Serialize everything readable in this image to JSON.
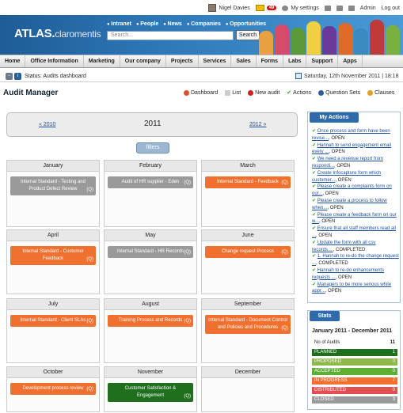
{
  "topbar": {
    "user": "Nigel Davies",
    "badge": "49",
    "settings": "My settings",
    "admin": "Admin",
    "logout": "Log out"
  },
  "banner": {
    "logo_main": "ATLAS.",
    "logo_sub": "claromentis",
    "radios": [
      "Intranet",
      "People",
      "News",
      "Companies",
      "Opportunities"
    ],
    "search_placeholder": "Search...",
    "search_button": "Search"
  },
  "nav": [
    "Home",
    "Office Information",
    "Marketing",
    "Our company",
    "Projects",
    "Services",
    "Sales",
    "Forms",
    "Labs",
    "Support",
    "Apps"
  ],
  "status": {
    "text": "Status: Audits dashboard",
    "date": "Saturday, 12th November 2011 | 18:18"
  },
  "page": {
    "title": "Audit Manager",
    "toolbar": [
      "Dashboard",
      "List",
      "New audit",
      "Actions",
      "Question Sets",
      "Clauses"
    ]
  },
  "year_nav": {
    "prev": "« 2010",
    "year": "2011",
    "next": "2012 »"
  },
  "filters": "filters",
  "months": [
    {
      "name": "January",
      "items": [
        {
          "text": "Internal Standard - Testing and Product Defect Review",
          "tag": "(Q)",
          "color": "gray"
        }
      ]
    },
    {
      "name": "February",
      "items": [
        {
          "text": "Audit of HR supplier - Eden",
          "tag": "(Q)",
          "color": "gray"
        }
      ]
    },
    {
      "name": "March",
      "items": [
        {
          "text": "Internal Standard - Feedback",
          "tag": "(Q)",
          "color": "orange"
        }
      ]
    },
    {
      "name": "April",
      "items": [
        {
          "text": "Internal Standard - Customer Feedback",
          "tag": "(Q)",
          "color": "orange"
        }
      ]
    },
    {
      "name": "May",
      "items": [
        {
          "text": "Internal Standard - HR Records",
          "tag": "(Q)",
          "color": "gray"
        }
      ]
    },
    {
      "name": "June",
      "items": [
        {
          "text": "Change request Process",
          "tag": "(Q)",
          "color": "orange"
        }
      ]
    },
    {
      "name": "July",
      "items": [
        {
          "text": "Internal Standard - Client SLAs",
          "tag": "(Q)",
          "color": "orange"
        }
      ]
    },
    {
      "name": "August",
      "items": [
        {
          "text": "Training Process and Records",
          "tag": "(Q)",
          "color": "orange"
        }
      ]
    },
    {
      "name": "September",
      "items": [
        {
          "text": "Internal Standard - Document Control and Policies and Procedures",
          "tag": "(Q)",
          "color": "orange"
        }
      ]
    },
    {
      "name": "October",
      "items": [
        {
          "text": "Development process review",
          "tag": "(Q)",
          "color": "orange"
        }
      ]
    },
    {
      "name": "November",
      "items": [
        {
          "text": "Customer Satisfaction & Engagement",
          "tag": "(Q)",
          "color": "green"
        }
      ]
    },
    {
      "name": "December",
      "items": []
    }
  ],
  "my_actions": {
    "title": "My Actions",
    "items": [
      {
        "link": "Once process and form have been revise...",
        "status": ", OPEN"
      },
      {
        "link": "Hannah to send engagement email every ...",
        "status": ", OPEN"
      },
      {
        "link": "We need a revenue report from respondi...",
        "status": ", OPEN"
      },
      {
        "link": "Create Infocapture form which customer...",
        "status": ", OPEN"
      },
      {
        "link": "Please create a complaints form on our...",
        "status": ", OPEN"
      },
      {
        "link": "Please create a process to follow when...",
        "status": ", OPEN"
      },
      {
        "link": "Please create a feedback form on our w...",
        "status": ", OPEN"
      },
      {
        "link": "Ensure that all staff members read all ...",
        "status": ", OPEN"
      },
      {
        "link": "Update the form with all csv records....",
        "status": ", COMPLETED"
      },
      {
        "link": "1. Hannah to re-do the change request ...",
        "status": ", COMPLETED"
      },
      {
        "link": "Hannah to re-do enhancements requests ...",
        "status": ", OPEN"
      },
      {
        "link": "Managers to be more serious while appr...",
        "status": ", OPEN"
      }
    ]
  },
  "stats": {
    "title": "Stats",
    "range": "January 2011 - December 2011",
    "total_label": "No of Audits",
    "total": "11",
    "rows": [
      {
        "label": "PLANNED",
        "value": "1",
        "color": "#1f6f1f"
      },
      {
        "label": "PROPOSED",
        "value": "0",
        "color": "#8fb84a"
      },
      {
        "label": "ACCEPTED",
        "value": "0",
        "color": "#5fb030"
      },
      {
        "label": "IN PROGRESS",
        "value": "7",
        "color": "#f07030"
      },
      {
        "label": "DISTRIBUTED",
        "value": "0",
        "color": "#e05050"
      },
      {
        "label": "CLOSED",
        "value": "3",
        "color": "#9a9a9a"
      }
    ]
  }
}
